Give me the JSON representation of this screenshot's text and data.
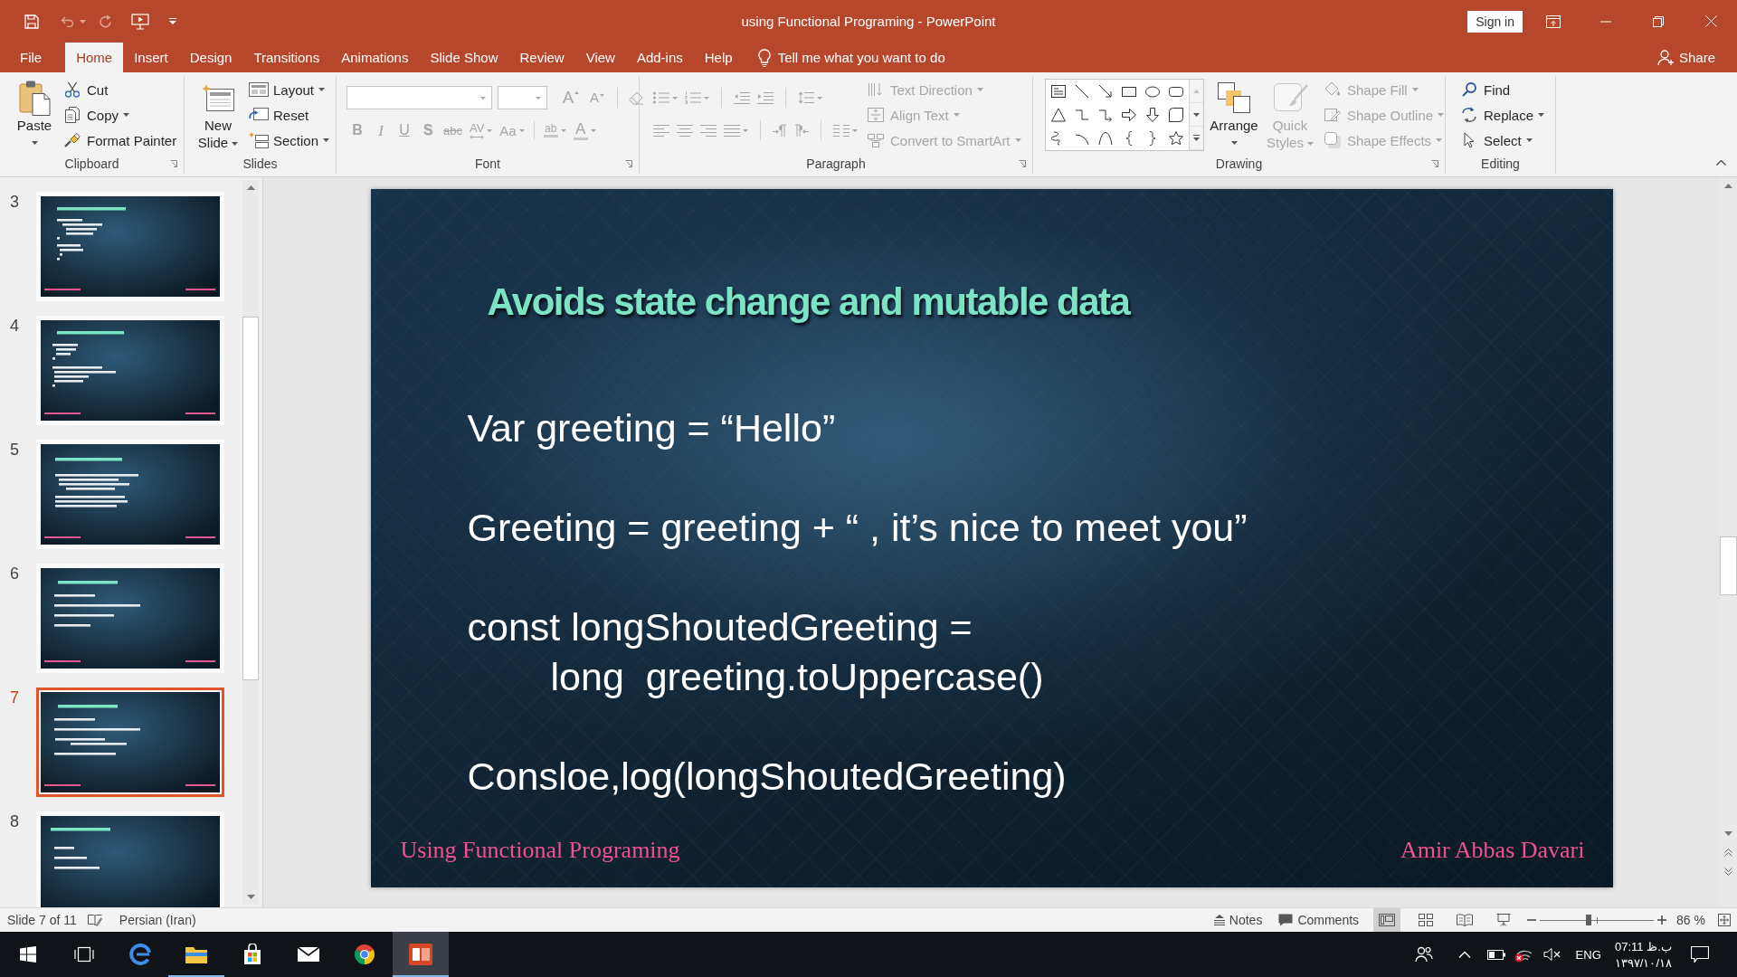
{
  "title_bar": {
    "title": "using Functional Programing - PowerPoint",
    "sign_in": "Sign in"
  },
  "tabs": [
    {
      "label": "File",
      "selected": false
    },
    {
      "label": "Home",
      "selected": true
    },
    {
      "label": "Insert",
      "selected": false
    },
    {
      "label": "Design",
      "selected": false
    },
    {
      "label": "Transitions",
      "selected": false
    },
    {
      "label": "Animations",
      "selected": false
    },
    {
      "label": "Slide Show",
      "selected": false
    },
    {
      "label": "Review",
      "selected": false
    },
    {
      "label": "View",
      "selected": false
    },
    {
      "label": "Add-ins",
      "selected": false
    },
    {
      "label": "Help",
      "selected": false
    }
  ],
  "tell_me": {
    "placeholder": "Tell me what you want to do"
  },
  "share": "Share",
  "ribbon": {
    "clipboard": {
      "label": "Clipboard",
      "paste": {
        "label": "Paste",
        "dropdown": true
      },
      "items": [
        {
          "kind": "cut",
          "label": "Cut",
          "dropdown": false
        },
        {
          "kind": "copy",
          "label": "Copy",
          "dropdown": true
        },
        {
          "kind": "painter",
          "label": "Format Painter",
          "dropdown": false
        }
      ]
    },
    "slides": {
      "label": "Slides",
      "new_slide": {
        "label": "New Slide",
        "dropdown": true
      },
      "items": [
        {
          "kind": "layout",
          "label": "Layout",
          "dropdown": true
        },
        {
          "kind": "reset",
          "label": "Reset",
          "dropdown": false
        },
        {
          "kind": "section",
          "label": "Section",
          "dropdown": true
        }
      ]
    },
    "font": {
      "label": "Font",
      "disabled": true,
      "size_buttons": [
        {
          "kind": "grow",
          "glyph": "A"
        },
        {
          "kind": "shrink",
          "glyph": "A"
        }
      ],
      "format_buttons": [
        {
          "kind": "bold",
          "glyph": "B",
          "dropdown": false
        },
        {
          "kind": "italic",
          "glyph": "I",
          "dropdown": false
        },
        {
          "kind": "underline",
          "glyph": "U",
          "dropdown": false
        },
        {
          "kind": "shadow",
          "glyph": "S",
          "dropdown": false
        },
        {
          "kind": "strike",
          "glyph": "abc",
          "dropdown": false
        },
        {
          "kind": "spacing",
          "glyph": "AV",
          "dropdown": true
        },
        {
          "kind": "case",
          "glyph": "Aa",
          "dropdown": true
        },
        {
          "kind": "highlight",
          "glyph": "ab",
          "dropdown": true
        },
        {
          "kind": "color",
          "glyph": "A",
          "dropdown": true
        }
      ]
    },
    "paragraph": {
      "label": "Paragraph",
      "disabled": true,
      "items": [
        {
          "kind": "direction",
          "label": "Text Direction",
          "dropdown": true
        },
        {
          "kind": "align",
          "label": "Align Text",
          "dropdown": true
        },
        {
          "kind": "smartart",
          "label": "Convert to SmartArt",
          "dropdown": true
        }
      ]
    },
    "drawing": {
      "label": "Drawing",
      "arrange": {
        "label": "Arrange",
        "dropdown": true,
        "disabled": false
      },
      "quick_styles": {
        "label": "Quick Styles",
        "dropdown": true,
        "disabled": true
      },
      "items": [
        {
          "kind": "fill",
          "label": "Shape Fill",
          "dropdown": true,
          "disabled": true
        },
        {
          "kind": "outline",
          "label": "Shape Outline",
          "dropdown": true,
          "disabled": true
        },
        {
          "kind": "effects",
          "label": "Shape Effects",
          "dropdown": true,
          "disabled": true
        }
      ]
    },
    "editing": {
      "label": "Editing",
      "items": [
        {
          "kind": "find",
          "label": "Find",
          "dropdown": false
        },
        {
          "kind": "replace",
          "label": "Replace",
          "dropdown": true
        },
        {
          "kind": "select",
          "label": "Select",
          "dropdown": true
        }
      ]
    }
  },
  "thumbnails": [
    {
      "number": "3",
      "selected": false
    },
    {
      "number": "4",
      "selected": false
    },
    {
      "number": "5",
      "selected": false
    },
    {
      "number": "6",
      "selected": false
    },
    {
      "number": "7",
      "selected": true
    },
    {
      "number": "8",
      "selected": false
    }
  ],
  "slide": {
    "title": "Avoids state change and mutable data",
    "blocks": [
      [
        {
          "kind": "line",
          "text": "Var greeting = “Hello”"
        }
      ],
      [
        {
          "kind": "line",
          "text": "Greeting = greeting + “ , it’s nice to meet you”"
        }
      ],
      [
        {
          "kind": "line",
          "text": "const longShoutedGreeting ="
        },
        {
          "kind": "nested",
          "text": "long  greeting.toUppercase()"
        }
      ],
      [
        {
          "kind": "line",
          "text": "Consloe,log(longShoutedGreeting)"
        }
      ]
    ],
    "footer_left": "Using Functional Programing",
    "footer_right": "Amir Abbas Davari"
  },
  "status_bar": {
    "slide_info": "Slide 7 of 11",
    "language": "Persian (Iran)",
    "notes": "Notes",
    "comments": "Comments",
    "views": [
      {
        "kind": "normal",
        "selected": true
      },
      {
        "kind": "sorter",
        "selected": false
      },
      {
        "kind": "reading",
        "selected": false
      },
      {
        "kind": "show",
        "selected": false
      }
    ],
    "zoom": {
      "level": 0.43,
      "reading": "86 %"
    }
  },
  "taskbar": {
    "apps": [
      {
        "kind": "edge",
        "running": false,
        "selected": false
      },
      {
        "kind": "folder",
        "running": true,
        "selected": false
      },
      {
        "kind": "store",
        "running": false,
        "selected": false
      },
      {
        "kind": "mail",
        "running": false,
        "selected": false
      },
      {
        "kind": "chrome",
        "running": false,
        "selected": false
      },
      {
        "kind": "slides",
        "running": true,
        "selected": true
      }
    ]
  },
  "tray": {
    "language": "ENG",
    "time": "07:11 ب.ظ",
    "date": "۱۳۹۷/۱۰/۱۸"
  }
}
